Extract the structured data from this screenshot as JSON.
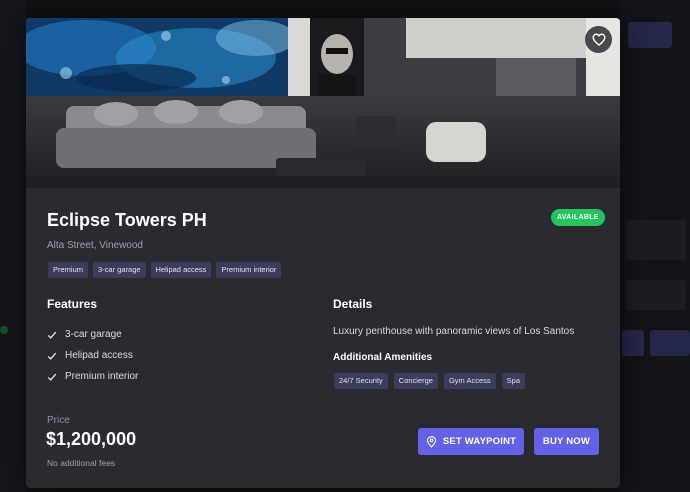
{
  "property": {
    "title": "Eclipse Towers PH",
    "status": "AVAILABLE",
    "address": "Alta Street, Vinewood",
    "tags": [
      "Premium",
      "3-car garage",
      "Helipad access",
      "Premium interior"
    ]
  },
  "features": {
    "heading": "Features",
    "items": [
      "3-car garage",
      "Helipad access",
      "Premium interior"
    ]
  },
  "details": {
    "heading": "Details",
    "description": "Luxury penthouse with panoramic views of Los Santos",
    "amenities_heading": "Additional Amenities",
    "amenities": [
      "24/7 Security",
      "Concierge",
      "Gym Access",
      "Spa"
    ]
  },
  "pricing": {
    "label": "Price",
    "value": "$1,200,000",
    "note": "No additional fees"
  },
  "actions": {
    "waypoint_label": "SET WAYPOINT",
    "buy_label": "BUY NOW"
  },
  "icons": {
    "favorite": "heart-icon",
    "waypoint": "map-pin-icon",
    "check": "check-icon"
  },
  "colors": {
    "accent": "#6362e6",
    "available": "#22c55e",
    "card": "#2a2b31",
    "tag": "#3a3c5c"
  }
}
